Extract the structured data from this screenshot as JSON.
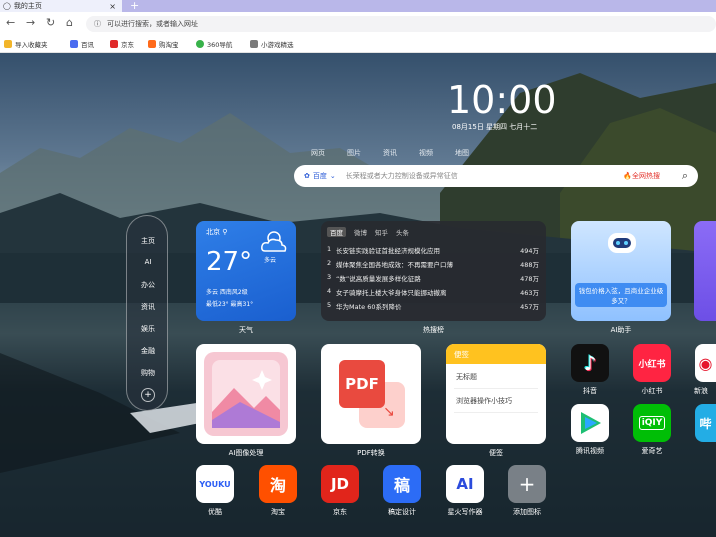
{
  "browser": {
    "tab_title": "我的主页",
    "new_tab": "+",
    "address_placeholder": "可以进行搜索，或者输入网址",
    "bookmarks": [
      "导入收藏夹",
      "百讯",
      "京东",
      "购淘宝",
      "360导航",
      "小游戏精选"
    ]
  },
  "clock": {
    "time": "10:00",
    "date": "08月15日 星期四 七月十二"
  },
  "search": {
    "tabs": [
      "网页",
      "图片",
      "资讯",
      "视频",
      "地图"
    ],
    "engine": "百度",
    "placeholder": "长荣程或者大力控制设备或异常征信",
    "hot_label": "全网热搜"
  },
  "side_nav": {
    "items": [
      "主页",
      "AI",
      "办公",
      "资讯",
      "娱乐",
      "金融",
      "购物"
    ],
    "add": "+"
  },
  "weather": {
    "location": "北京",
    "temp": "27°",
    "condition": "多云",
    "line1": "多云   西南风2级",
    "line2": "最低23° 最高31°",
    "caption": "天气"
  },
  "hot_list": {
    "tabs": [
      "百度",
      "微博",
      "知乎",
      "头条"
    ],
    "items": [
      {
        "n": "1",
        "title": "长安链实践验证首批经济规模化应用",
        "count": "494万"
      },
      {
        "n": "2",
        "title": "媒体聚焦全国各地成效：不再需要户口薄",
        "count": "488万"
      },
      {
        "n": "3",
        "title": "“数”说高质量发展多样化征路",
        "count": "478万"
      },
      {
        "n": "4",
        "title": "女子骑摩托上楼大爷身体只能挪动撤离",
        "count": "463万"
      },
      {
        "n": "5",
        "title": "华为Mate 60系列降价",
        "count": "457万"
      }
    ],
    "caption": "热搜榜"
  },
  "ai_card": {
    "text": "钱包价格入弦，且商业企业级多又？",
    "caption": "AI助手"
  },
  "big_apps": [
    {
      "label": "AI图像处理"
    },
    {
      "label": "PDF转换",
      "icon_text": "PDF"
    },
    {
      "label": "便签"
    }
  ],
  "notes": {
    "header": "便签",
    "rows": [
      "无标题",
      "浏览器操作小技巧"
    ]
  },
  "right_apps": [
    {
      "label": "抖音"
    },
    {
      "label": "小红书",
      "icon_text": "小红书"
    },
    {
      "label": "新浪"
    },
    {
      "label": "腾讯视频"
    },
    {
      "label": "爱奇艺",
      "icon_text": "iQIY"
    },
    {
      "label": "哔"
    }
  ],
  "bottom_apps": [
    {
      "label": "优酷",
      "icon_text": "YOUKU"
    },
    {
      "label": "淘宝",
      "icon_text": "淘"
    },
    {
      "label": "京东",
      "icon_text": "JD"
    },
    {
      "label": "稿定设计",
      "icon_text": "稿"
    },
    {
      "label": "星火写作器",
      "icon_text": "AI"
    },
    {
      "label": "添加图标",
      "icon_text": "+"
    }
  ]
}
